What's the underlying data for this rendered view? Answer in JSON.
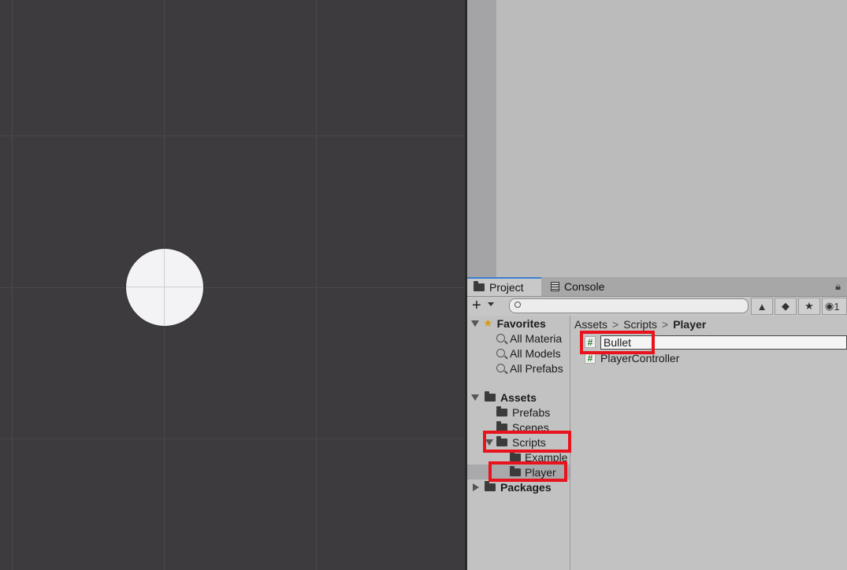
{
  "tabs": {
    "project": "Project",
    "console": "Console"
  },
  "toolbar": {
    "add": "+",
    "search_value": "",
    "visibility_count": "1"
  },
  "tree": {
    "favorites": "Favorites",
    "fav_items": [
      "All Materia",
      "All Models",
      "All Prefabs"
    ],
    "assets": "Assets",
    "prefabs": "Prefabs",
    "scenes": "Scenes",
    "scripts": "Scripts",
    "example": "Example",
    "player": "Player",
    "packages": "Packages"
  },
  "breadcrumb": {
    "assets": "Assets",
    "scripts": "Scripts",
    "player": "Player",
    "sep": ">"
  },
  "files": {
    "rename_value": "Bullet",
    "player_controller": "PlayerController",
    "script_icon": "#"
  },
  "colors": {
    "highlight": "#e8131d",
    "tab_accent": "#3d7fd1",
    "scene_bg": "#3d3b3e"
  }
}
